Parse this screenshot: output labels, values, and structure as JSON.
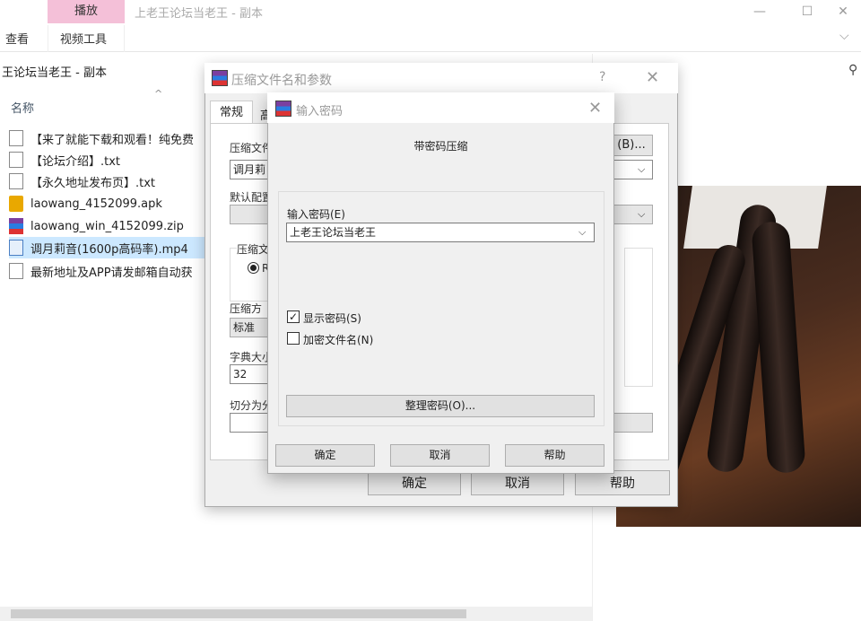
{
  "explorer": {
    "ribbon_group_label": "播放",
    "window_title": "上老王论坛当老王 - 副本",
    "tabs": [
      "查看",
      "视频工具"
    ],
    "address_text": "王论坛当老王 - 副本",
    "column_header": "名称",
    "files": [
      {
        "name": "【来了就能下载和观看！纯免费",
        "icon": "text-file-icon"
      },
      {
        "name": "【论坛介绍】.txt",
        "icon": "text-file-icon"
      },
      {
        "name": "【永久地址发布页】.txt",
        "icon": "text-file-icon"
      },
      {
        "name": "laowang_4152099.apk",
        "icon": "apk-file-icon"
      },
      {
        "name": "laowang_win_4152099.zip",
        "icon": "zip-archive-icon"
      },
      {
        "name": "调月莉音(1600p高码率).mp4",
        "icon": "video-file-icon",
        "selected": true
      },
      {
        "name": "最新地址及APP请发邮箱自动获",
        "icon": "text-file-icon"
      }
    ]
  },
  "archive_dialog": {
    "title": "压缩文件名和参数",
    "help": "?",
    "tab_general": "常规",
    "tab_advanced": "高",
    "label_archive_name": "压缩文件",
    "archive_name_value": "调月莉",
    "browse_label": "(B)...",
    "label_default_profile": "默认配置",
    "label_format": "压缩文",
    "format_radio_text": "R",
    "label_method": "压缩方",
    "method_value": "标准",
    "label_dictionary": "字典大小",
    "dictionary_value": "32",
    "label_split": "切分为分",
    "ok_label": "确定",
    "cancel_label": "取消",
    "help_label": "帮助"
  },
  "password_dialog": {
    "title": "输入密码",
    "heading": "带密码压缩",
    "password_label": "输入密码(E)",
    "password_value": "上老王论坛当老王",
    "show_password_label": "显示密码(S)",
    "show_password_checked": true,
    "encrypt_names_label": "加密文件名(N)",
    "encrypt_names_checked": false,
    "manage_button": "整理密码(O)...",
    "ok_label": "确定",
    "cancel_label": "取消",
    "help_label": "帮助"
  }
}
